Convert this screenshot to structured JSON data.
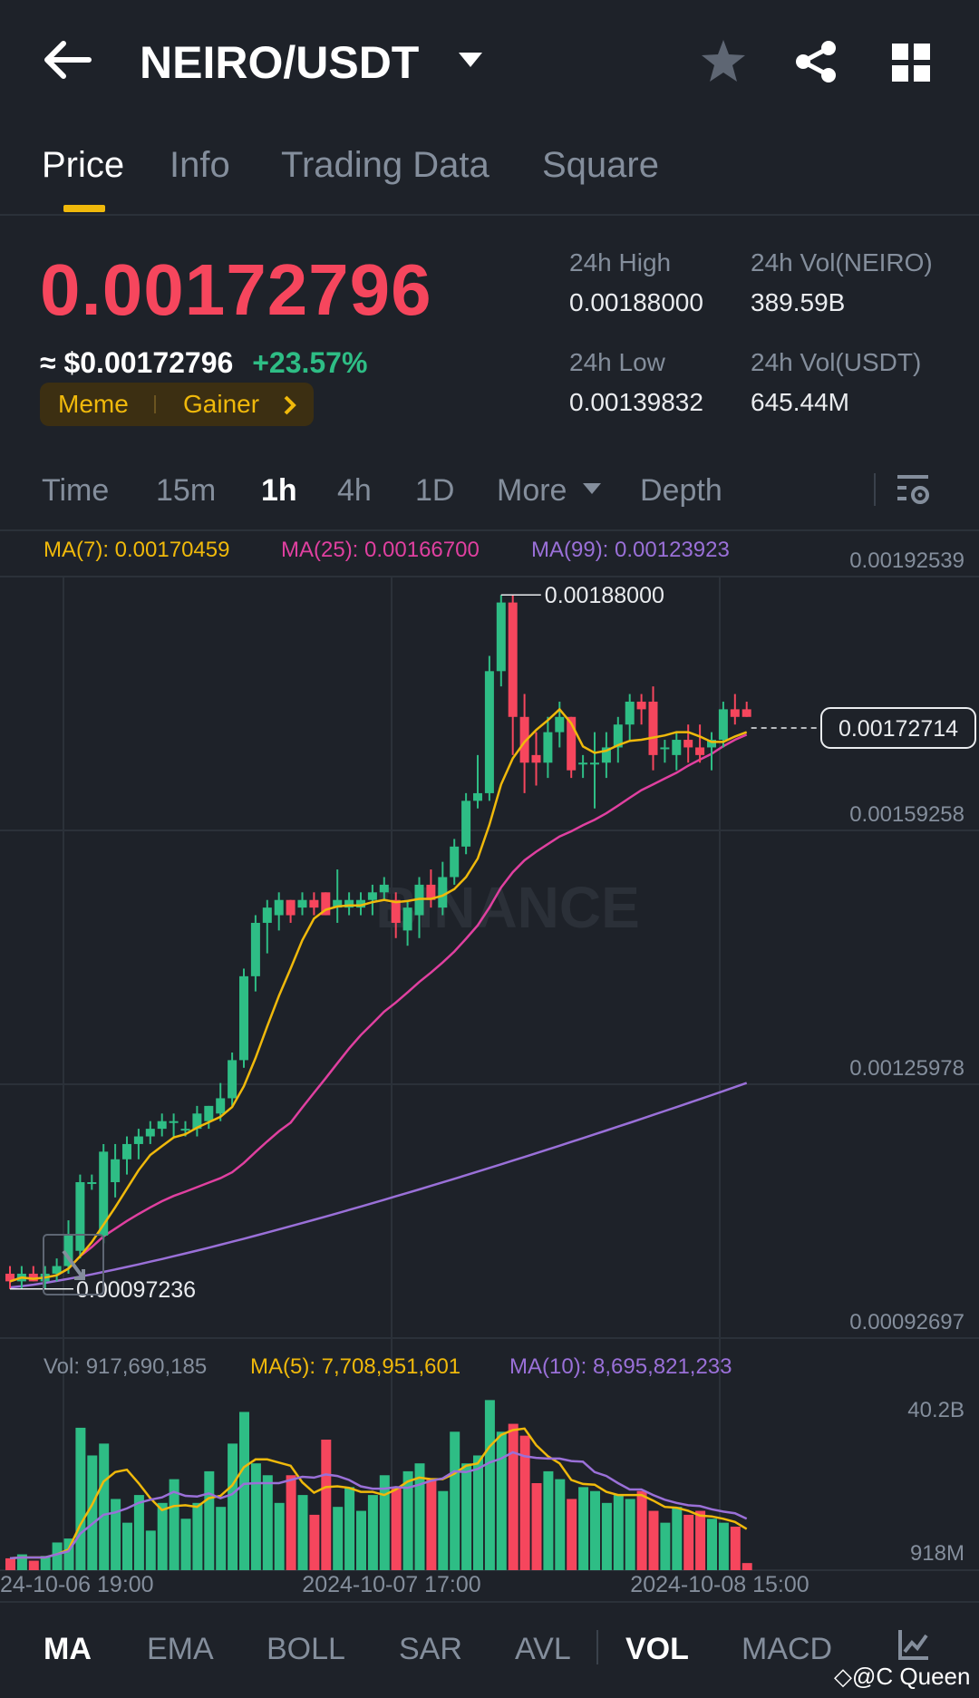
{
  "header": {
    "pair": "NEIRO/USDT"
  },
  "tabs": [
    {
      "label": "Price"
    },
    {
      "label": "Info"
    },
    {
      "label": "Trading Data"
    },
    {
      "label": "Square"
    }
  ],
  "price": {
    "last": "0.00172796",
    "usd": "≈ $0.00172796",
    "change": "+23.57%",
    "tags": [
      "Meme",
      "Gainer"
    ]
  },
  "stats": {
    "high_label": "24h High",
    "high_value": "0.00188000",
    "low_label": "24h Low",
    "low_value": "0.00139832",
    "vol_base_label": "24h Vol(NEIRO)",
    "vol_base_value": "389.59B",
    "vol_quote_label": "24h Vol(USDT)",
    "vol_quote_value": "645.44M"
  },
  "intervals": [
    "Time",
    "15m",
    "1h",
    "4h",
    "1D",
    "More",
    "Depth"
  ],
  "active_interval": "1h",
  "ma_legend": {
    "ma7": "MA(7): 0.00170459",
    "ma25": "MA(25): 0.00166700",
    "ma99": "MA(99): 0.00123923"
  },
  "vol_legend": {
    "vol": "Vol: 917,690,185",
    "ma5": "MA(5): 7,708,951,601",
    "ma10": "MA(10): 8,695,821,233"
  },
  "bottom_bar": [
    "MA",
    "EMA",
    "BOLL",
    "SAR",
    "AVL",
    "VOL",
    "MACD"
  ],
  "watermark": "BINANCE",
  "credit": "@C Queen",
  "colors": {
    "up": "#2ebd85",
    "down": "#f6465d",
    "ma7": "#f0b90b",
    "ma25": "#e040a0",
    "ma99": "#9a70d8",
    "accent": "#f0b90b"
  },
  "chart_data": {
    "type": "candlestick",
    "price_axis_ticks": [
      "0.00192539",
      "0.00159258",
      "0.00125978",
      "0.00092697"
    ],
    "volume_axis_ticks": [
      "40.2B",
      "918M"
    ],
    "time_labels": [
      "24-10-06 19:00",
      "2024-10-07 17:00",
      "2024-10-08 15:00"
    ],
    "high_marker": "0.00188000",
    "low_marker": "0.00097236",
    "current_price_label": "0.00172714",
    "candles": [
      [
        0.00099,
        0.001,
        0.00097,
        0.00098
      ],
      [
        0.00098,
        0.001,
        0.00097,
        0.00099
      ],
      [
        0.00099,
        0.001,
        0.00098,
        0.00098
      ],
      [
        0.00098,
        0.001,
        0.00097,
        0.00099
      ],
      [
        0.00099,
        0.00101,
        0.00098,
        0.001
      ],
      [
        0.001,
        0.00106,
        0.00099,
        0.00104
      ],
      [
        0.00102,
        0.00112,
        0.00101,
        0.00111
      ],
      [
        0.00111,
        0.00112,
        0.0011,
        0.00111
      ],
      [
        0.00104,
        0.00116,
        0.00103,
        0.00115
      ],
      [
        0.00111,
        0.00116,
        0.00109,
        0.00114
      ],
      [
        0.00114,
        0.00117,
        0.00112,
        0.00116
      ],
      [
        0.00116,
        0.00118,
        0.00114,
        0.00117
      ],
      [
        0.00117,
        0.00119,
        0.00116,
        0.00118
      ],
      [
        0.00118,
        0.0012,
        0.00117,
        0.00119
      ],
      [
        0.00119,
        0.0012,
        0.00117,
        0.00119
      ],
      [
        0.00118,
        0.00119,
        0.00117,
        0.00118
      ],
      [
        0.00118,
        0.00121,
        0.00117,
        0.0012
      ],
      [
        0.00119,
        0.00121,
        0.00118,
        0.00121
      ],
      [
        0.0012,
        0.00124,
        0.00119,
        0.00122
      ],
      [
        0.00122,
        0.00128,
        0.00121,
        0.00127
      ],
      [
        0.00127,
        0.00139,
        0.00126,
        0.00138
      ],
      [
        0.00138,
        0.00146,
        0.00136,
        0.00145
      ],
      [
        0.00145,
        0.00148,
        0.00141,
        0.00147
      ],
      [
        0.00146,
        0.00149,
        0.00144,
        0.00148
      ],
      [
        0.00148,
        0.00148,
        0.00145,
        0.00146
      ],
      [
        0.00147,
        0.00149,
        0.00146,
        0.00148
      ],
      [
        0.00148,
        0.00149,
        0.00146,
        0.00147
      ],
      [
        0.00149,
        0.00149,
        0.00146,
        0.00146
      ],
      [
        0.00147,
        0.00152,
        0.00145,
        0.00148
      ],
      [
        0.00147,
        0.00149,
        0.00146,
        0.00148
      ],
      [
        0.00147,
        0.00149,
        0.00146,
        0.00148
      ],
      [
        0.00148,
        0.0015,
        0.00146,
        0.00149
      ],
      [
        0.00149,
        0.00151,
        0.00148,
        0.0015
      ],
      [
        0.00148,
        0.00149,
        0.00143,
        0.00145
      ],
      [
        0.00144,
        0.00148,
        0.00142,
        0.00147
      ],
      [
        0.00146,
        0.00151,
        0.00143,
        0.0015
      ],
      [
        0.0015,
        0.00152,
        0.00147,
        0.00148
      ],
      [
        0.00147,
        0.00153,
        0.00146,
        0.00151
      ],
      [
        0.00151,
        0.00156,
        0.0015,
        0.00155
      ],
      [
        0.00155,
        0.00162,
        0.00154,
        0.00161
      ],
      [
        0.00161,
        0.00167,
        0.0016,
        0.00162
      ],
      [
        0.00162,
        0.0018,
        0.00161,
        0.00178
      ],
      [
        0.00178,
        0.00188,
        0.00176,
        0.00187
      ],
      [
        0.00187,
        0.00188,
        0.00167,
        0.00172
      ],
      [
        0.00172,
        0.00175,
        0.00162,
        0.00166
      ],
      [
        0.00167,
        0.0017,
        0.00163,
        0.00166
      ],
      [
        0.00166,
        0.00172,
        0.00164,
        0.0017
      ],
      [
        0.0017,
        0.00174,
        0.00168,
        0.00172
      ],
      [
        0.00172,
        0.00172,
        0.00164,
        0.00165
      ],
      [
        0.00166,
        0.00167,
        0.00164,
        0.00166
      ],
      [
        0.00166,
        0.0017,
        0.0016,
        0.00166
      ],
      [
        0.00166,
        0.0017,
        0.00164,
        0.00168
      ],
      [
        0.00168,
        0.00172,
        0.00166,
        0.00171
      ],
      [
        0.00171,
        0.00175,
        0.00169,
        0.00174
      ],
      [
        0.00174,
        0.00175,
        0.00171,
        0.00173
      ],
      [
        0.00174,
        0.00176,
        0.00165,
        0.00167
      ],
      [
        0.00168,
        0.00169,
        0.00166,
        0.00168
      ],
      [
        0.00167,
        0.0017,
        0.00165,
        0.00169
      ],
      [
        0.00169,
        0.00171,
        0.00166,
        0.00168
      ],
      [
        0.00168,
        0.00171,
        0.00166,
        0.00167
      ],
      [
        0.00168,
        0.0017,
        0.00165,
        0.00169
      ],
      [
        0.00169,
        0.00174,
        0.00168,
        0.00173
      ],
      [
        0.00173,
        0.00175,
        0.00171,
        0.00172
      ],
      [
        0.00173,
        0.00174,
        0.00172,
        0.00172
      ]
    ],
    "volumes": [
      1.5,
      2.0,
      1.2,
      1.8,
      3.5,
      4.0,
      18.0,
      14.5,
      16.0,
      9.0,
      6.0,
      9.5,
      5.0,
      8.5,
      11.5,
      6.5,
      8.5,
      12.5,
      8.0,
      16.0,
      20.0,
      13.5,
      12.0,
      8.5,
      12.0,
      9.5,
      7.0,
      16.5,
      8.0,
      10.5,
      7.5,
      9.5,
      12.0,
      10.5,
      12.5,
      13.5,
      11.5,
      10.0,
      17.5,
      13.5,
      14.5,
      21.5,
      17.5,
      18.5,
      17.0,
      11.0,
      12.5,
      11.5,
      9.0,
      10.5,
      10.0,
      8.5,
      9.5,
      9.0,
      10.0,
      7.5,
      6.0,
      8.0,
      7.0,
      7.5,
      6.5,
      6.0,
      5.5,
      0.9
    ],
    "ma5_volume": [
      1.5,
      1.6,
      1.6,
      1.6,
      2.0,
      2.6,
      5.7,
      8.2,
      11.2,
      12.4,
      12.7,
      11.0,
      9.1,
      7.6,
      8.1,
      8.2,
      8.0,
      9.1,
      9.4,
      10.7,
      13.0,
      14.0,
      14.0,
      13.6,
      13.2,
      11.1,
      9.8,
      10.5,
      10.6,
      10.4,
      9.9,
      9.9,
      9.5,
      10.2,
      11.2,
      11.7,
      11.5,
      11.5,
      12.2,
      13.2,
      13.5,
      15.6,
      17.1,
      17.7,
      17.9,
      15.8,
      14.4,
      13.5,
      11.4,
      10.9,
      10.8,
      9.9,
      9.5,
      9.5,
      9.5,
      8.8,
      8.0,
      7.9,
      7.5,
      6.9,
      6.8,
      6.5,
      6.1,
      5.2
    ],
    "ma10_volume": [
      1.5,
      1.6,
      1.6,
      1.6,
      2.0,
      2.4,
      4.6,
      5.8,
      7.0,
      7.3,
      7.8,
      8.5,
      8.9,
      9.2,
      9.9,
      9.4,
      9.3,
      9.7,
      9.1,
      9.6,
      10.9,
      11.0,
      11.0,
      11.0,
      11.4,
      11.8,
      11.7,
      12.1,
      11.9,
      11.4,
      10.6,
      10.3,
      10.3,
      10.5,
      10.4,
      10.8,
      11.3,
      11.6,
      12.5,
      12.4,
      12.8,
      13.6,
      14.1,
      14.9,
      14.4,
      14.2,
      14.1,
      14.1,
      13.8,
      13.7,
      12.4,
      11.9,
      11.0,
      10.2,
      10.2,
      9.5,
      8.9,
      8.5,
      8.2,
      8.1,
      7.7,
      7.4,
      7.2,
      6.5
    ]
  }
}
